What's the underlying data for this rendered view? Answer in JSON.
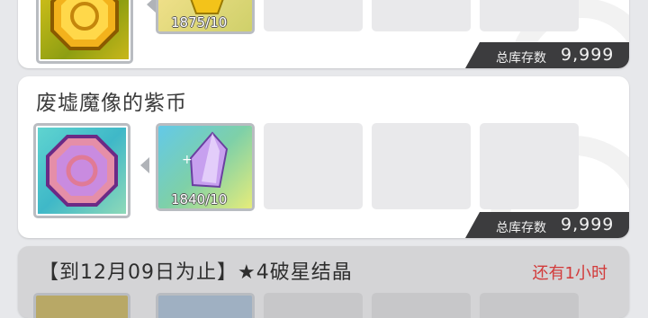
{
  "cards": [
    {
      "title": "",
      "material_count": "1875/10",
      "inventory_label": "总库存数",
      "inventory_value": "9,999"
    },
    {
      "title": "废墟魔像的紫币",
      "material_count": "1840/10",
      "inventory_label": "总库存数",
      "inventory_value": "9,999"
    },
    {
      "title": "【到12月09日为止】★4破星结晶",
      "timer": "还有1小时"
    }
  ],
  "icons": {
    "card1_main": "gold-coin-icon",
    "card1_material": "gold-crystal-icon",
    "card2_main": "purple-coin-icon",
    "card2_material": "purple-crystal-icon"
  },
  "colors": {
    "timer": "#d23a3a",
    "inventory_badge": "#3c3c3e"
  }
}
